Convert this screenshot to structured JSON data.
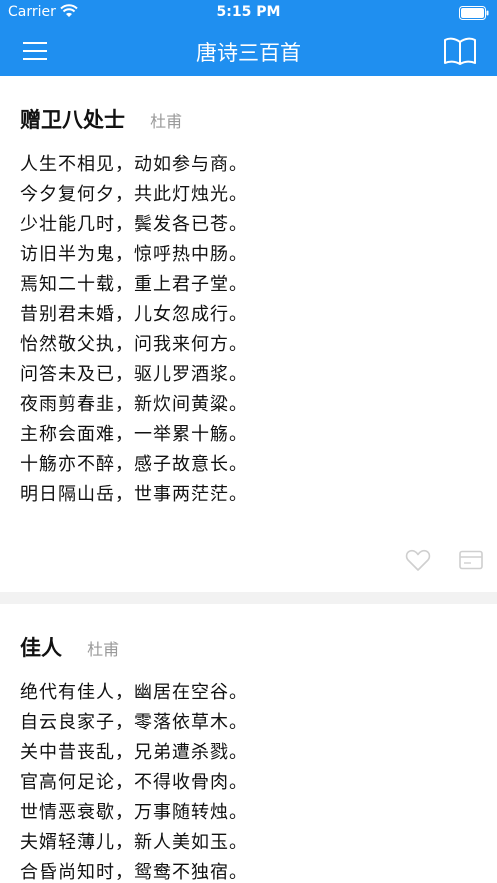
{
  "status_bar": {
    "carrier": "Carrier",
    "time": "5:15 PM"
  },
  "nav": {
    "title": "唐诗三百首"
  },
  "colors": {
    "accent": "#1f8ff0",
    "icon_gray": "#cfcfcf",
    "author_gray": "#9a9a9a"
  },
  "icons": {
    "menu": "hamburger-icon",
    "book": "book-icon",
    "like": "heart-icon",
    "comment": "comment-icon"
  },
  "poems": [
    {
      "title": "赠卫八处士",
      "author": "杜甫",
      "lines": [
        "人生不相见，动如参与商。",
        "今夕复何夕，共此灯烛光。",
        "少壮能几时，鬓发各已苍。",
        "访旧半为鬼，惊呼热中肠。",
        "焉知二十载，重上君子堂。",
        "昔别君未婚，儿女忽成行。",
        "怡然敬父执，问我来何方。",
        "问答未及已，驱儿罗酒浆。",
        "夜雨剪春韭，新炊间黄粱。",
        "主称会面难，一举累十觞。",
        "十觞亦不醉，感子故意长。",
        "明日隔山岳，世事两茫茫。"
      ]
    },
    {
      "title": "佳人",
      "author": "杜甫",
      "lines": [
        "绝代有佳人，幽居在空谷。",
        "自云良家子，零落依草木。",
        "关中昔丧乱，兄弟遭杀戮。",
        "官高何足论，不得收骨肉。",
        "世情恶衰歇，万事随转烛。",
        "夫婿轻薄儿，新人美如玉。",
        "合昏尚知时，鸳鸯不独宿。"
      ]
    }
  ]
}
